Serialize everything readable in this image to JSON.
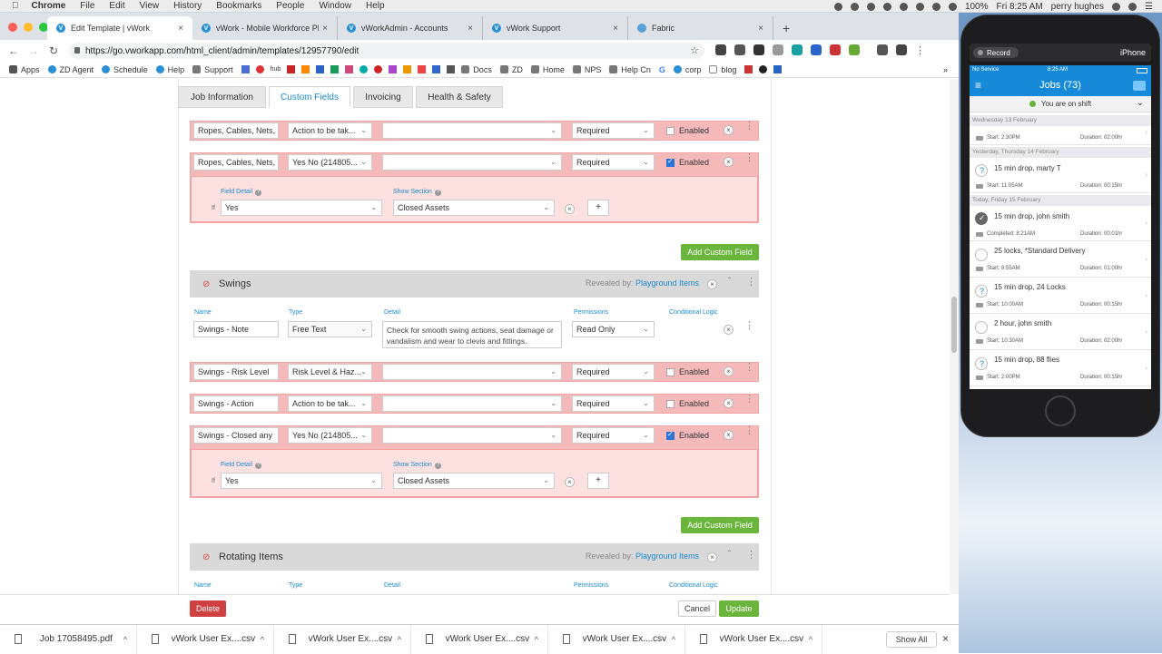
{
  "menubar": {
    "app": "Chrome",
    "items": [
      "File",
      "Edit",
      "View",
      "History",
      "Bookmarks",
      "People",
      "Window",
      "Help"
    ],
    "battery": "100%",
    "clock": "Fri 8:25 AM",
    "user": "perry hughes"
  },
  "browser": {
    "tabs": [
      {
        "title": "Edit Template | vWork",
        "active": true
      },
      {
        "title": "vWork - Mobile Workforce Platf",
        "active": false
      },
      {
        "title": "vWorkAdmin - Accounts",
        "active": false
      },
      {
        "title": "vWork Support",
        "active": false
      },
      {
        "title": "Fabric",
        "active": false
      }
    ],
    "url": "https://go.vworkapp.com/html_client/admin/templates/12957790/edit",
    "bookmarks": [
      "Apps",
      "ZD Agent",
      "Schedule",
      "Help",
      "Support",
      "hub",
      "Docs",
      "ZD",
      "Home",
      "NPS",
      "Help Cn",
      "G",
      "corp",
      "blog"
    ]
  },
  "page_tabs": [
    "Job Information",
    "Custom Fields",
    "Invoicing",
    "Health & Safety"
  ],
  "active_page_tab": "Custom Fields",
  "top_rows": [
    {
      "name": "Ropes, Cables, Nets,",
      "type": "Action to be tak...",
      "detail": "",
      "permission": "Required",
      "enabled_label": "Enabled",
      "enabled": false
    },
    {
      "name": "Ropes, Cables, Nets,",
      "type": "Yes No (214805...",
      "detail": "",
      "permission": "Required",
      "enabled_label": "Enabled",
      "enabled": true
    }
  ],
  "top_detail": {
    "field_detail_label": "Field Detail",
    "field_detail_value": "Yes",
    "show_section_label": "Show Section",
    "show_section_value": "Closed Assets",
    "if_label": "If",
    "plus": "+"
  },
  "add_custom_field_label": "Add Custom Field",
  "swings": {
    "title": "Swings",
    "revealed_prefix": "Revealed by:",
    "revealed_link": "Playground Items",
    "headers": {
      "name": "Name",
      "type": "Type",
      "detail": "Detail",
      "permissions": "Permissions",
      "logic": "Conditional Logic"
    },
    "rows": [
      {
        "name": "Swings - Note",
        "type": "Free Text",
        "detail": "Check for smooth swing actions, seat damage or vandalism and wear to clevis and fittings.",
        "permission": "Read Only",
        "red": false
      },
      {
        "name": "Swings - Risk Level",
        "type": "Risk Level & Haz...",
        "detail": "",
        "permission": "Required",
        "enabled_label": "Enabled",
        "enabled": false,
        "red": true
      },
      {
        "name": "Swings - Action",
        "type": "Action to be tak...",
        "detail": "",
        "permission": "Required",
        "enabled_label": "Enabled",
        "enabled": false,
        "red": true
      },
      {
        "name": "Swings - Closed any",
        "type": "Yes No (214805...",
        "detail": "",
        "permission": "Required",
        "enabled_label": "Enabled",
        "enabled": true,
        "red": true
      }
    ],
    "detail": {
      "field_detail_label": "Field Detail",
      "field_detail_value": "Yes",
      "show_section_label": "Show Section",
      "show_section_value": "Closed Assets",
      "if_label": "If",
      "plus": "+"
    }
  },
  "rotating": {
    "title": "Rotating Items",
    "revealed_prefix": "Revealed by:",
    "revealed_link": "Playground Items",
    "headers": {
      "name": "Name",
      "type": "Type",
      "detail": "Detail",
      "permissions": "Permissions",
      "logic": "Conditional Logic"
    }
  },
  "actions": {
    "delete": "Delete",
    "cancel": "Cancel",
    "update": "Update"
  },
  "downloads": {
    "items": [
      "Job 17058495.pdf",
      "vWork User Ex....csv",
      "vWork User Ex....csv",
      "vWork User Ex....csv",
      "vWork User Ex....csv",
      "vWork User Ex....csv"
    ],
    "show_all": "Show All"
  },
  "phone": {
    "record": "Record",
    "device": "iPhone",
    "status_left": "No Service",
    "status_time": "8:25 AM",
    "title": "Jobs (73)",
    "shift": "You are on shift",
    "days": [
      "Wednesday 13 February",
      "Yesterday, Thursday 14 February",
      "Today, Friday 15 February"
    ],
    "jobs": [
      {
        "title": "",
        "start": "Start: 2:30PM",
        "duration": "Duration: 02:00hr"
      },
      {
        "title": "15 min drop, marty T",
        "start": "Start: 11:05AM",
        "duration": "Duration: 00:15hr"
      },
      {
        "title": "15 min drop, john smith",
        "start": "Completed: 8:21AM",
        "duration": "Duration: 00:01hr"
      },
      {
        "title": "25 locks, *Standard Delivery",
        "start": "Start: 8:55AM",
        "duration": "Duration: 01:00hr"
      },
      {
        "title": "15 min drop, 24 Locks",
        "start": "Start: 10:00AM",
        "duration": "Duration: 00:15hr"
      },
      {
        "title": "2 hour, john smith",
        "start": "Start: 10:30AM",
        "duration": "Duration: 02:00hr"
      },
      {
        "title": "15 min drop, 88 flies",
        "start": "Start: 2:00PM",
        "duration": "Duration: 00:15hr"
      }
    ]
  }
}
